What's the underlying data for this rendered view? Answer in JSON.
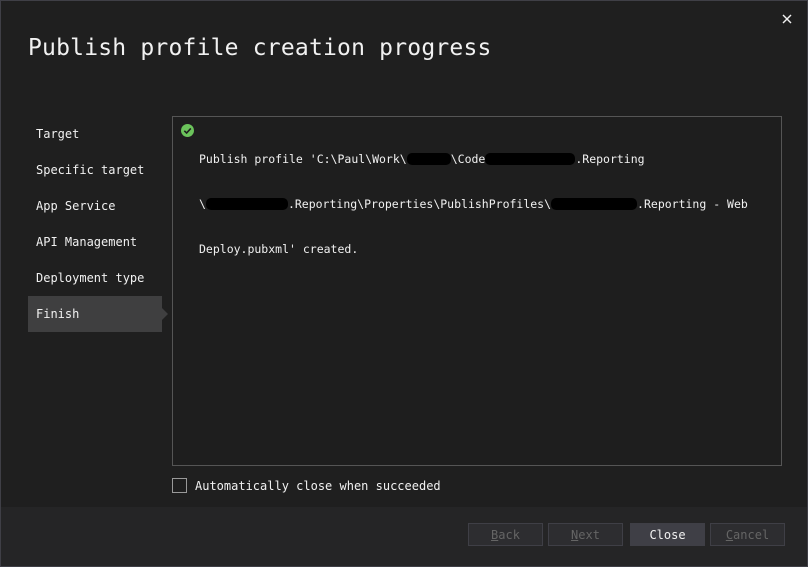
{
  "dialog": {
    "title": "Publish profile creation progress",
    "close_icon": "close-icon"
  },
  "steps": [
    {
      "label": "Target",
      "active": false
    },
    {
      "label": "Specific target",
      "active": false
    },
    {
      "label": "App Service",
      "active": false
    },
    {
      "label": "API Management",
      "active": false
    },
    {
      "label": "Deployment type",
      "active": false
    },
    {
      "label": "Finish",
      "active": true
    }
  ],
  "output": {
    "status_icon": "success-check-icon",
    "status_color": "#6bc35b",
    "message": {
      "line1_a": "Publish profile 'C:\\Paul\\Work\\",
      "line1_b": "\\Code",
      "line1_c": ".Reporting",
      "line2_a": "\\",
      "line2_b": ".Reporting\\Properties\\PublishProfiles\\",
      "line2_c": ".Reporting - Web",
      "line3": "Deploy.pubxml' created."
    }
  },
  "auto_close": {
    "label": "Automatically close when succeeded",
    "checked": false
  },
  "buttons": {
    "back": {
      "label": "Back",
      "access_key": "B",
      "rest": "ack",
      "enabled": false
    },
    "next": {
      "label": "Next",
      "access_key": "N",
      "rest": "ext",
      "enabled": false
    },
    "close": {
      "label": "Close",
      "enabled": true
    },
    "cancel": {
      "label": "Cancel",
      "access_key": "C",
      "rest": "ancel",
      "enabled": false
    }
  }
}
